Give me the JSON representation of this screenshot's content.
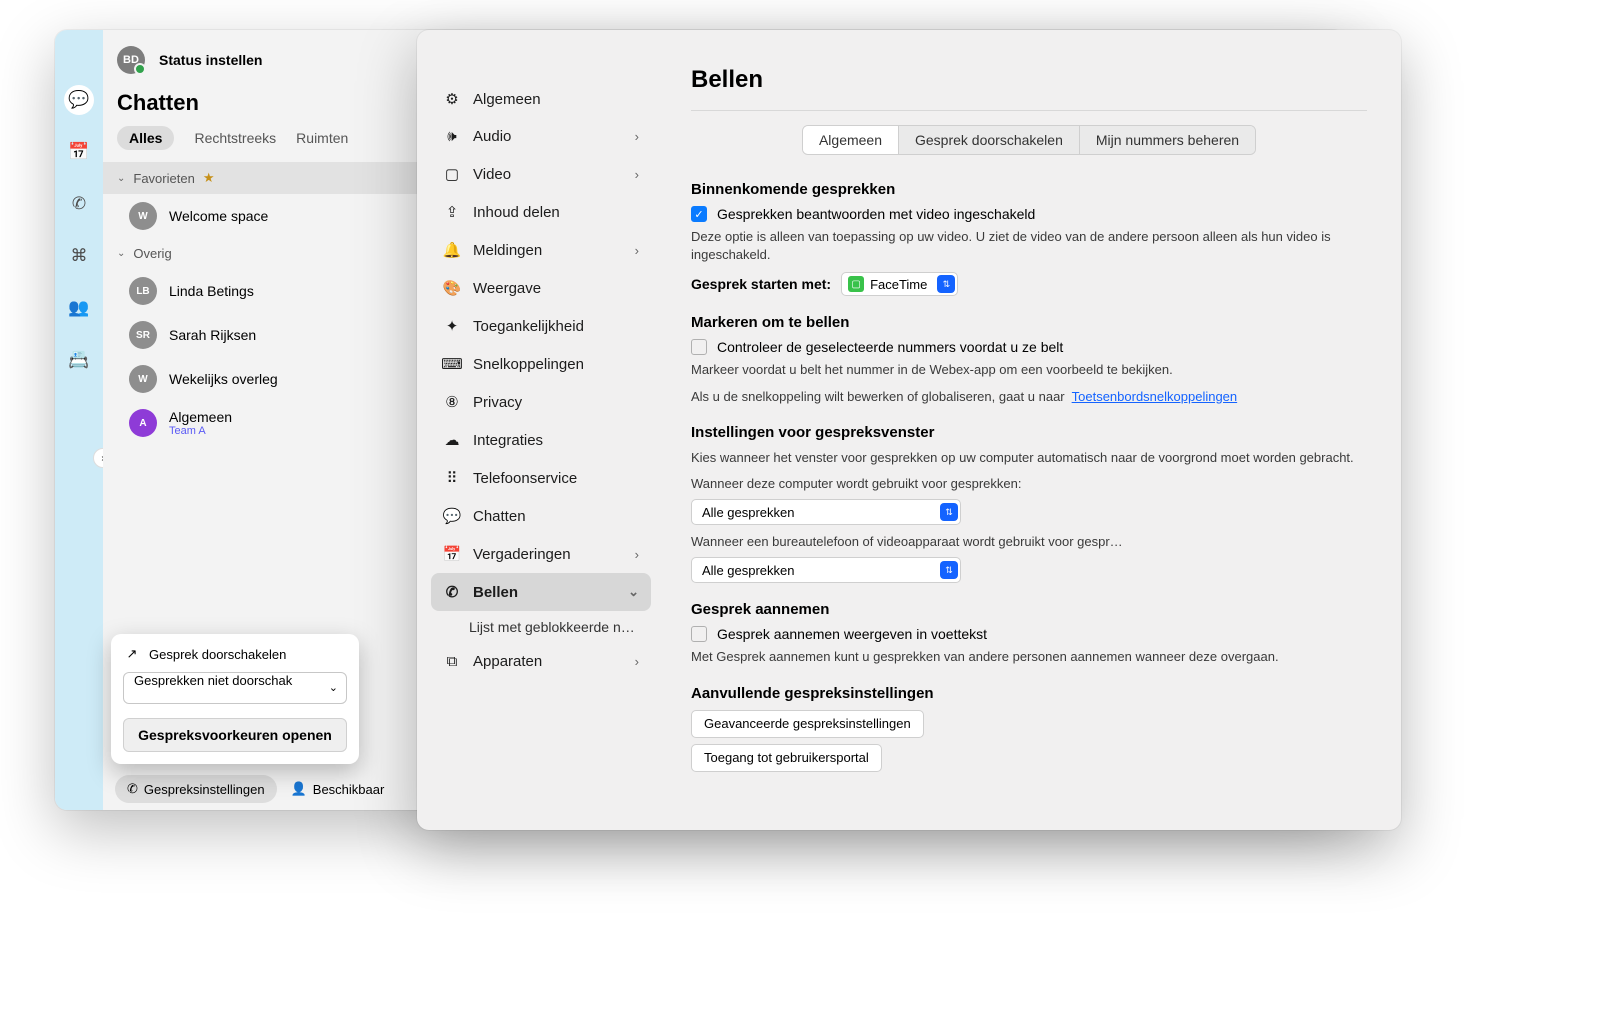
{
  "header": {
    "avatar_initials": "BD",
    "status_text": "Status instellen"
  },
  "chat": {
    "title": "Chatten",
    "tabs": {
      "all": "Alles",
      "direct": "Rechtstreeks",
      "rooms": "Ruimten"
    },
    "fav_label": "Favorieten",
    "other_label": "Overig",
    "items": {
      "welcome": {
        "initial": "W",
        "name": "Welcome space",
        "bg": "#8e8e8e"
      },
      "linda": {
        "initial": "LB",
        "name": "Linda Betings",
        "bg": "#8e8e8e"
      },
      "sarah": {
        "initial": "SR",
        "name": "Sarah Rijksen",
        "bg": "#8e8e8e"
      },
      "weekly": {
        "initial": "W",
        "name": "Wekelijks overleg",
        "bg": "#8e8e8e"
      },
      "algemeen": {
        "initial": "A",
        "name": "Algemeen",
        "sub": "Team A",
        "bg": "#8e3bd7"
      }
    }
  },
  "popover": {
    "title": "Gesprek doorschakelen",
    "select_value": "Gesprekken niet doorschak",
    "open_prefs": "Gespreksvoorkeuren openen"
  },
  "footer": {
    "call_settings": "Gespreksinstellingen",
    "available": "Beschikbaar"
  },
  "settings_nav": [
    {
      "icon": "⚙︎",
      "label": "Algemeen"
    },
    {
      "icon": "🕪",
      "label": "Audio",
      "chev": true
    },
    {
      "icon": "▢",
      "label": "Video",
      "chev": true
    },
    {
      "icon": "⇪",
      "label": "Inhoud delen"
    },
    {
      "icon": "🔔",
      "label": "Meldingen",
      "chev": true
    },
    {
      "icon": "🎨",
      "label": "Weergave"
    },
    {
      "icon": "✦",
      "label": "Toegankelijkheid"
    },
    {
      "icon": "⌨",
      "label": "Snelkoppelingen"
    },
    {
      "icon": "⑧",
      "label": "Privacy"
    },
    {
      "icon": "☁",
      "label": "Integraties"
    },
    {
      "icon": "⠿",
      "label": "Telefoonservice"
    },
    {
      "icon": "💬",
      "label": "Chatten"
    },
    {
      "icon": "📅",
      "label": "Vergaderingen",
      "chev": true
    },
    {
      "icon": "✆",
      "label": "Bellen",
      "chev": true,
      "active": true
    },
    {
      "icon": "",
      "label": "Lijst met geblokkeerde num…",
      "sub": true
    },
    {
      "icon": "⧉",
      "label": "Apparaten",
      "chev": true
    }
  ],
  "settings": {
    "title": "Bellen",
    "tabs": {
      "a": "Algemeen",
      "b": "Gesprek doorschakelen",
      "c": "Mijn nummers beheren"
    },
    "incoming": {
      "heading": "Binnenkomende gesprekken",
      "chk_label": "Gesprekken beantwoorden met video ingeschakeld",
      "desc": "Deze optie is alleen van toepassing op uw video. U ziet de video van de andere persoon alleen als hun video is ingeschakeld.",
      "start_with_label": "Gesprek starten met:",
      "start_with_value": "FaceTime"
    },
    "mark": {
      "heading": "Markeren om te bellen",
      "chk_label": "Controleer de geselecteerde nummers voordat u ze belt",
      "desc": "Markeer voordat u belt het nummer in de Webex-app om een voorbeeld te bekijken.",
      "shortcut_pre": "Als u de snelkoppeling wilt bewerken of globaliseren, gaat u naar",
      "shortcut_link": "Toetsenbordsnelkoppelingen"
    },
    "window": {
      "heading": "Instellingen voor gespreksvenster",
      "desc": "Kies wanneer het venster voor gesprekken op uw computer automatisch naar de voorgrond moet worden gebracht.",
      "q1": "Wanneer deze computer wordt gebruikt voor gesprekken:",
      "v1": "Alle gesprekken",
      "q2": "Wanneer een bureautelefoon of videoapparaat wordt gebruikt voor gespr…",
      "v2": "Alle gesprekken"
    },
    "pickup": {
      "heading": "Gesprek aannemen",
      "chk_label": "Gesprek aannemen weergeven in voettekst",
      "desc": "Met Gesprek aannemen kunt u gesprekken van andere personen aannemen wanneer deze overgaan."
    },
    "extra": {
      "heading": "Aanvullende gespreksinstellingen",
      "btn1": "Geavanceerde gespreksinstellingen",
      "btn2": "Toegang tot gebruikersportal"
    }
  }
}
